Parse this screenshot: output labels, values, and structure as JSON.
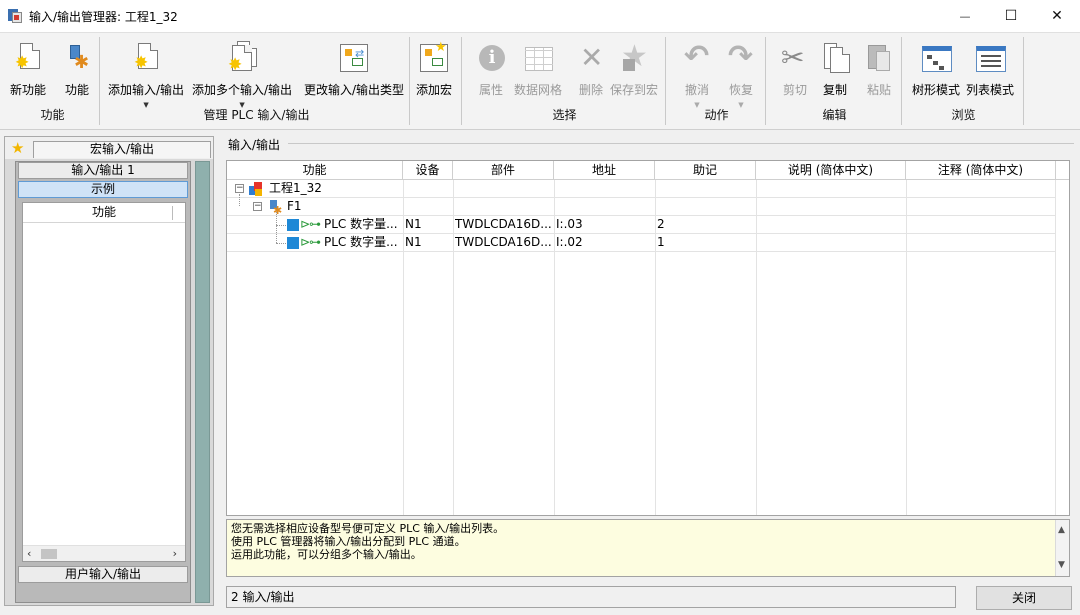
{
  "window": {
    "title": "输入/输出管理器: 工程1_32",
    "minimize": "—",
    "maximize": "☐",
    "close": "✕"
  },
  "ribbon": {
    "groups": [
      {
        "name": "功能",
        "buttons": [
          {
            "label": "新功能",
            "icon": "new-function-icon"
          },
          {
            "label": "功能",
            "icon": "function-icon"
          }
        ]
      },
      {
        "name": "管理 PLC 输入/输出",
        "buttons": [
          {
            "label": "添加输入/输出",
            "icon": "add-io-icon"
          },
          {
            "label": "添加多个输入/输出",
            "icon": "add-multiple-io-icon"
          },
          {
            "label": "更改输入/输出类型",
            "icon": "change-io-type-icon"
          }
        ]
      },
      {
        "name": "",
        "buttons": [
          {
            "label": "添加宏",
            "icon": "add-macro-icon"
          }
        ]
      },
      {
        "name": "选择",
        "buttons": [
          {
            "label": "属性",
            "icon": "properties-icon"
          },
          {
            "label": "数据网格",
            "icon": "data-grid-icon"
          },
          {
            "label": "删除",
            "icon": "delete-icon"
          },
          {
            "label": "保存到宏",
            "icon": "save-to-macro-icon"
          }
        ]
      },
      {
        "name": "动作",
        "buttons": [
          {
            "label": "撤消",
            "icon": "undo-icon"
          },
          {
            "label": "恢复",
            "icon": "redo-icon"
          }
        ]
      },
      {
        "name": "编辑",
        "buttons": [
          {
            "label": "剪切",
            "icon": "cut-icon"
          },
          {
            "label": "复制",
            "icon": "copy-icon"
          },
          {
            "label": "粘贴",
            "icon": "paste-icon"
          }
        ]
      },
      {
        "name": "浏览",
        "buttons": [
          {
            "label": "树形模式",
            "icon": "tree-mode-icon"
          },
          {
            "label": "列表模式",
            "icon": "list-mode-icon"
          }
        ]
      }
    ]
  },
  "left_panel": {
    "tab": "宏输入/输出",
    "section1": "输入/输出 1",
    "selected": "示例",
    "list_header": "功能",
    "section2": "用户输入/输出"
  },
  "main": {
    "section_label": "输入/输出",
    "columns": [
      "功能",
      "设备",
      "部件",
      "地址",
      "助记",
      "说明 (简体中文)",
      "注释 (简体中文)"
    ],
    "tree": {
      "project": "工程1_32",
      "function": "F1"
    },
    "rows": [
      {
        "function": "PLC 数字量...",
        "device": "N1",
        "part": "TWDLCDA16D...",
        "address": "I:.03",
        "mnemonic": "2",
        "description": "",
        "comment": ""
      },
      {
        "function": "PLC 数字量...",
        "device": "N1",
        "part": "TWDLCDA16D...",
        "address": "I:.02",
        "mnemonic": "1",
        "description": "",
        "comment": ""
      }
    ],
    "info_lines": [
      "您无需选择相应设备型号便可定义 PLC 输入/输出列表。",
      "使用 PLC 管理器将输入/输出分配到 PLC 通道。",
      "运用此功能，可以分组多个输入/输出。"
    ],
    "status": "2 输入/输出",
    "close_button": "关闭"
  },
  "colors": {
    "ribbon_bg": "#f3f3f3",
    "selected_bg": "#cfe3f7",
    "info_bg": "#fdfde0",
    "strip": "#8fb0ad"
  }
}
